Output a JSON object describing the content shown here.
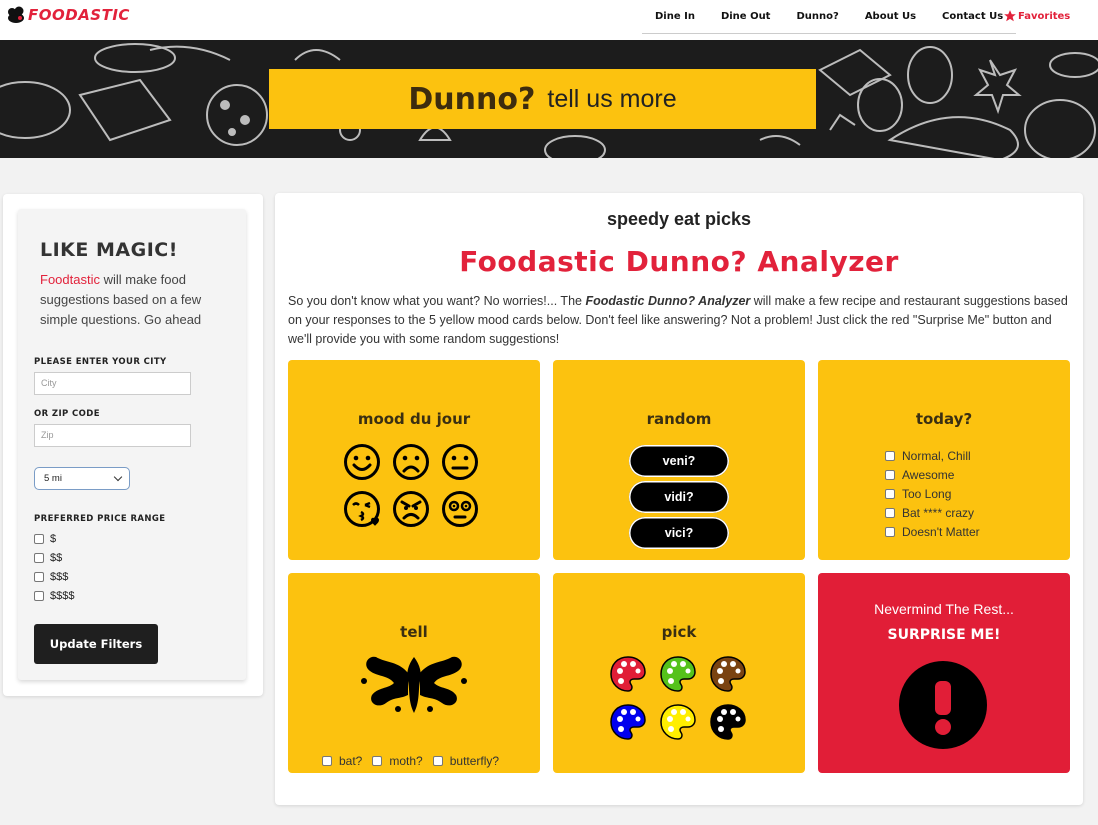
{
  "brand": {
    "name": "FOODASTIC"
  },
  "nav": {
    "links": [
      "Dine In",
      "Dine Out",
      "Dunno?",
      "About Us",
      "Contact Us"
    ],
    "favorites": "Favorites"
  },
  "hero": {
    "title": "Dunno?",
    "subtitle": "tell us more"
  },
  "sidebar": {
    "title": "LIKE MAGIC!",
    "brand_word": "Foodtastic",
    "text": " will make food suggestions based on a few simple questions. Go ahead",
    "city_label": "PLEASE ENTER YOUR CITY",
    "city_placeholder": "City",
    "zip_label": "OR ZIP CODE",
    "zip_placeholder": "Zip",
    "distance": "5 mi",
    "price_label": "PREFERRED PRICE RANGE",
    "prices": [
      "$",
      "$$",
      "$$$",
      "$$$$"
    ],
    "update_button": "Update Filters"
  },
  "main": {
    "kicker": "speedy eat picks",
    "title": "Foodastic Dunno? Analyzer",
    "desc_1": "So you don't know what you want? No worries!... The ",
    "desc_bold": "Foodastic Dunno? Analyzer",
    "desc_2": " will make a few recipe and restaurant suggestions based on your responses to the 5 yellow mood cards below. Don't feel like answering? Not a problem! Just click the red \"Surprise Me\" button and we'll provide you with some random suggestions!"
  },
  "cards": {
    "mood": {
      "title": "mood du jour",
      "faces": [
        "smile",
        "frown",
        "neutral",
        "kiss",
        "angry",
        "flushed"
      ]
    },
    "random": {
      "title": "random",
      "buttons": [
        "veni?",
        "vidi?",
        "vici?"
      ]
    },
    "today": {
      "title": "today?",
      "options": [
        "Normal, Chill",
        "Awesome",
        "Too Long",
        "Bat **** crazy",
        "Doesn't Matter"
      ]
    },
    "tell": {
      "title": "tell",
      "options": [
        "bat?",
        "moth?",
        "butterfly?"
      ]
    },
    "pick": {
      "title": "pick",
      "palettes": [
        "#e11e37",
        "#55c21b",
        "#7a4311",
        "#0000ee",
        "#ffee00",
        "#000000"
      ]
    },
    "surprise": {
      "line1": "Nevermind The Rest...",
      "line2": "SURPRISE ME!"
    }
  },
  "colors": {
    "brand_red": "#e11e37",
    "mood_yellow": "#fcc20f",
    "dark": "#1f1f1f"
  }
}
